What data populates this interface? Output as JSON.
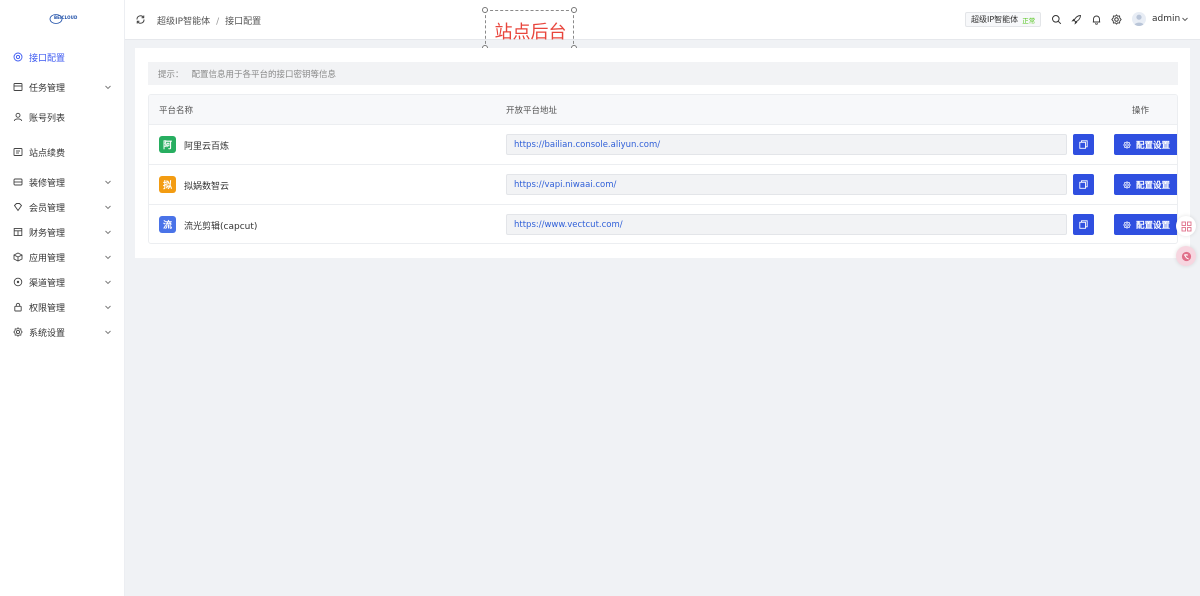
{
  "logo": {
    "text": "BEICLOUD"
  },
  "sidebar": {
    "items": [
      {
        "label": "接口配置",
        "icon": "settings-icon",
        "active": true,
        "expandable": false
      },
      {
        "label": "任务管理",
        "icon": "task-icon",
        "active": false,
        "expandable": true
      },
      {
        "label": "账号列表",
        "icon": "user-icon",
        "active": false,
        "expandable": false
      },
      {
        "label": "站点续费",
        "icon": "renew-icon",
        "active": false,
        "expandable": false
      },
      {
        "label": "装修管理",
        "icon": "decorate-icon",
        "active": false,
        "expandable": true
      },
      {
        "label": "会员管理",
        "icon": "member-icon",
        "active": false,
        "expandable": true
      },
      {
        "label": "财务管理",
        "icon": "finance-icon",
        "active": false,
        "expandable": true
      },
      {
        "label": "应用管理",
        "icon": "app-icon",
        "active": false,
        "expandable": true
      },
      {
        "label": "渠道管理",
        "icon": "channel-icon",
        "active": false,
        "expandable": true
      },
      {
        "label": "权限管理",
        "icon": "lock-icon",
        "active": false,
        "expandable": true
      },
      {
        "label": "系统设置",
        "icon": "gear-icon",
        "active": false,
        "expandable": true
      }
    ]
  },
  "header": {
    "breadcrumb": [
      "超级IP智能体",
      "接口配置"
    ],
    "separator": "/",
    "overlay_title": "站点后台",
    "site": {
      "name": "超级IP智能体",
      "status": "正常"
    },
    "user": {
      "name": "admin"
    }
  },
  "main": {
    "tip": {
      "label": "提示：",
      "text": "配置信息用于各平台的接口密钥等信息"
    },
    "table": {
      "headers": {
        "platform": "平台名称",
        "url": "开放平台地址",
        "actions": "操作"
      },
      "rows": [
        {
          "icon_char": "阿",
          "icon_color": "#27ae60",
          "name": "阿里云百炼",
          "url": "https://bailian.console.aliyun.com/",
          "action": "配置设置"
        },
        {
          "icon_char": "拟",
          "icon_color": "#f39c12",
          "name": "拟娲数智云",
          "url": "https://vapi.niwaai.com/",
          "action": "配置设置"
        },
        {
          "icon_char": "流",
          "icon_color": "#4a73e8",
          "name": "流光剪辑(capcut)",
          "url": "https://www.vectcut.com/",
          "action": "配置设置"
        }
      ]
    }
  },
  "colors": {
    "accent": "#3d5af1",
    "button": "#2f4fe0",
    "overlay_text": "#e8453c",
    "status_ok": "#52c41a"
  }
}
